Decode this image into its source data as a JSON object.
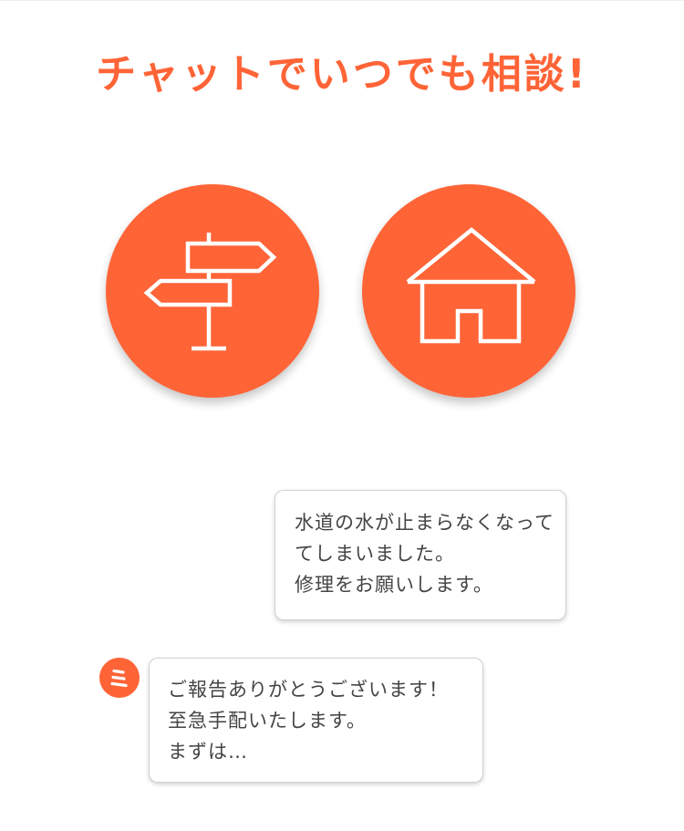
{
  "headline": "チャットでいつでも相談!",
  "colors": {
    "accent": "#FF6437",
    "icon_stroke": "#FFFFFF",
    "bubble_text": "#444444",
    "bubble_border": "#D2D2D2"
  },
  "icons": {
    "left": "signpost-icon",
    "right": "house-icon",
    "avatar": "chat-operator-avatar-icon"
  },
  "chat": {
    "user_message": {
      "lines": [
        "水道の水が止まらなくなって",
        "てしまいました。",
        "修理をお願いします。"
      ]
    },
    "bot_message": {
      "lines": [
        "ご報告ありがとうございます！",
        "至急手配いたします。",
        "まずは…"
      ]
    }
  }
}
